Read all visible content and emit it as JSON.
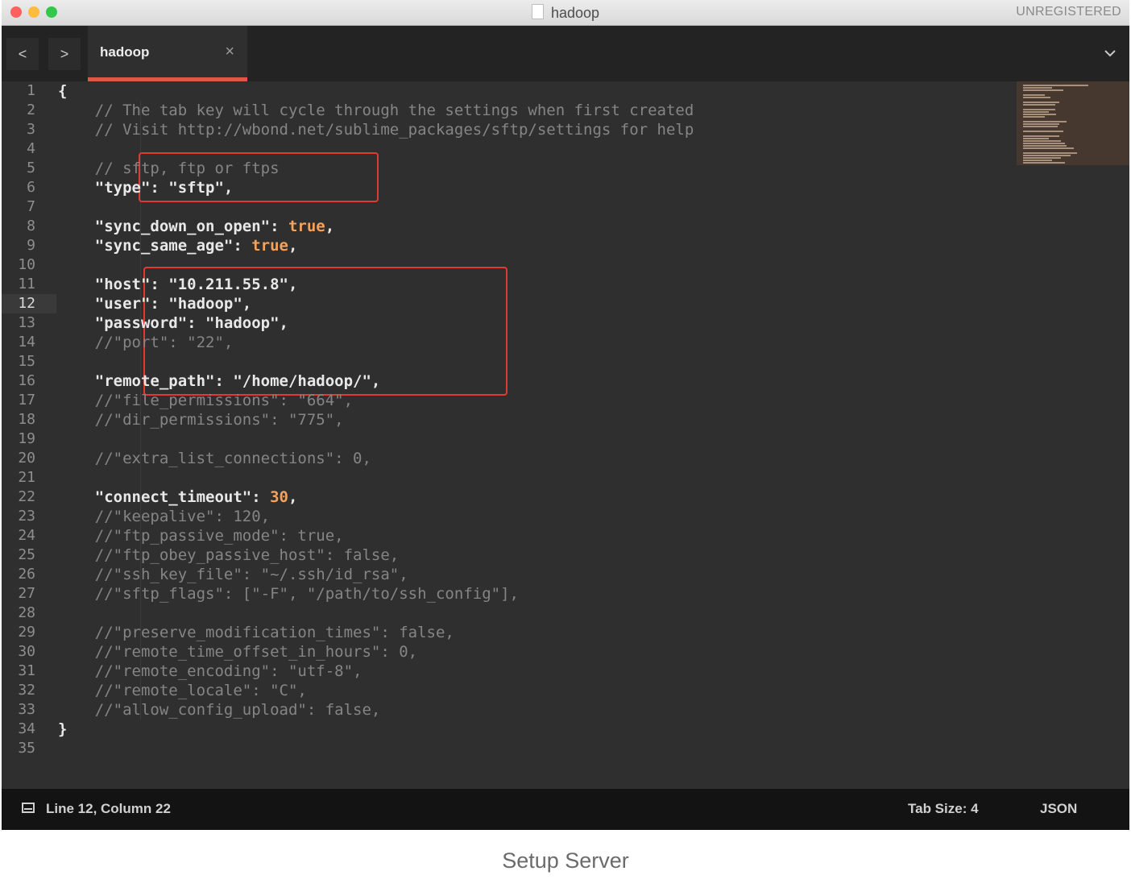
{
  "window": {
    "title": "hadoop",
    "registration_status": "UNREGISTERED"
  },
  "tabbar": {
    "back_label": "<",
    "forward_label": ">",
    "tab_label": "hadoop",
    "tab_close_label": "×"
  },
  "editor": {
    "active_line": 12,
    "lines": [
      {
        "n": "1",
        "text": "{",
        "kind": "code"
      },
      {
        "n": "2",
        "text": "    // The tab key will cycle through the settings when first created",
        "kind": "comment"
      },
      {
        "n": "3",
        "text": "    // Visit http://wbond.net/sublime_packages/sftp/settings for help",
        "kind": "comment"
      },
      {
        "n": "4",
        "text": "",
        "kind": "code"
      },
      {
        "n": "5",
        "text": "    // sftp, ftp or ftps",
        "kind": "comment"
      },
      {
        "n": "6",
        "text": "    \"type\": \"sftp\",",
        "kind": "code"
      },
      {
        "n": "7",
        "text": "",
        "kind": "code"
      },
      {
        "n": "8",
        "text": "    \"sync_down_on_open\": true,",
        "kind": "bool"
      },
      {
        "n": "9",
        "text": "    \"sync_same_age\": true,",
        "kind": "bool"
      },
      {
        "n": "10",
        "text": "",
        "kind": "code"
      },
      {
        "n": "11",
        "text": "    \"host\": \"10.211.55.8\",",
        "kind": "code"
      },
      {
        "n": "12",
        "text": "    \"user\": \"hadoop\",",
        "kind": "code"
      },
      {
        "n": "13",
        "text": "    \"password\": \"hadoop\",",
        "kind": "code"
      },
      {
        "n": "14",
        "text": "    //\"port\": \"22\",",
        "kind": "comment"
      },
      {
        "n": "15",
        "text": "",
        "kind": "code"
      },
      {
        "n": "16",
        "text": "    \"remote_path\": \"/home/hadoop/\",",
        "kind": "code"
      },
      {
        "n": "17",
        "text": "    //\"file_permissions\": \"664\",",
        "kind": "comment"
      },
      {
        "n": "18",
        "text": "    //\"dir_permissions\": \"775\",",
        "kind": "comment"
      },
      {
        "n": "19",
        "text": "",
        "kind": "code"
      },
      {
        "n": "20",
        "text": "    //\"extra_list_connections\": 0,",
        "kind": "comment"
      },
      {
        "n": "21",
        "text": "",
        "kind": "code"
      },
      {
        "n": "22",
        "text": "    \"connect_timeout\": 30,",
        "kind": "num"
      },
      {
        "n": "23",
        "text": "    //\"keepalive\": 120,",
        "kind": "comment"
      },
      {
        "n": "24",
        "text": "    //\"ftp_passive_mode\": true,",
        "kind": "comment"
      },
      {
        "n": "25",
        "text": "    //\"ftp_obey_passive_host\": false,",
        "kind": "comment"
      },
      {
        "n": "26",
        "text": "    //\"ssh_key_file\": \"~/.ssh/id_rsa\",",
        "kind": "comment"
      },
      {
        "n": "27",
        "text": "    //\"sftp_flags\": [\"-F\", \"/path/to/ssh_config\"],",
        "kind": "comment"
      },
      {
        "n": "28",
        "text": "",
        "kind": "code"
      },
      {
        "n": "29",
        "text": "    //\"preserve_modification_times\": false,",
        "kind": "comment"
      },
      {
        "n": "30",
        "text": "    //\"remote_time_offset_in_hours\": 0,",
        "kind": "comment"
      },
      {
        "n": "31",
        "text": "    //\"remote_encoding\": \"utf-8\",",
        "kind": "comment"
      },
      {
        "n": "32",
        "text": "    //\"remote_locale\": \"C\",",
        "kind": "comment"
      },
      {
        "n": "33",
        "text": "    //\"allow_config_upload\": false,",
        "kind": "comment"
      },
      {
        "n": "34",
        "text": "}",
        "kind": "code"
      },
      {
        "n": "35",
        "text": "",
        "kind": "code"
      }
    ]
  },
  "statusbar": {
    "position": "Line 12, Column 22",
    "tab_size": "Tab Size: 4",
    "syntax": "JSON"
  },
  "caption": "Setup Server",
  "colors": {
    "tab_accent": "#e0564b",
    "annotation_box": "#e13b30",
    "literal": "#f5a25d"
  }
}
